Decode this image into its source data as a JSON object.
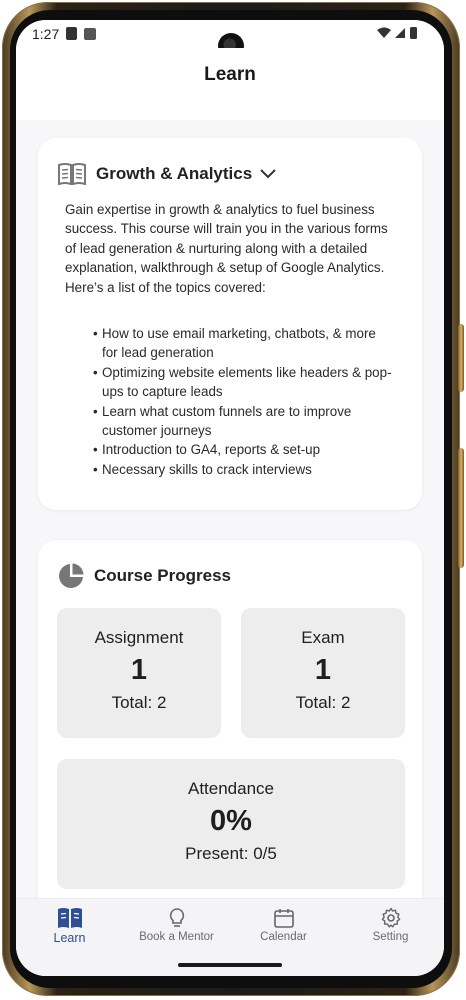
{
  "status_bar": {
    "time": "1:27"
  },
  "app_bar": {
    "title": "Learn"
  },
  "course": {
    "title": "Growth & Analytics",
    "description": "Gain expertise in growth & analytics to fuel business success. This course will train you in the various forms of lead generation & nurturing along with a detailed explanation, walkthrough & setup of Google Analytics. Here’s a list of the topics covered:",
    "topics": [
      "How to use email marketing, chatbots, & more for lead generation",
      "Optimizing website elements like headers & pop-ups to capture leads",
      "Learn what custom funnels are to improve customer journeys",
      "Introduction to GA4, reports & set-up",
      "Necessary skills to crack interviews"
    ]
  },
  "progress": {
    "title": "Course Progress",
    "assignment": {
      "label": "Assignment",
      "value": "1",
      "total": "Total: 2"
    },
    "exam": {
      "label": "Exam",
      "value": "1",
      "total": "Total: 2"
    },
    "attendance": {
      "label": "Attendance",
      "value": "0%",
      "present": "Present: 0/5"
    }
  },
  "nav": {
    "items": [
      {
        "label": "Learn",
        "icon": "book-icon",
        "active": true
      },
      {
        "label": "Book a Mentor",
        "icon": "lightbulb-icon",
        "active": false
      },
      {
        "label": "Calendar",
        "icon": "calendar-icon",
        "active": false
      },
      {
        "label": "Setting",
        "icon": "gear-icon",
        "active": false
      }
    ]
  },
  "colors": {
    "accent": "#2f4f94",
    "card_background": "#ffffff",
    "stat_background": "#ededed",
    "screen_background": "#f7f7f9"
  }
}
